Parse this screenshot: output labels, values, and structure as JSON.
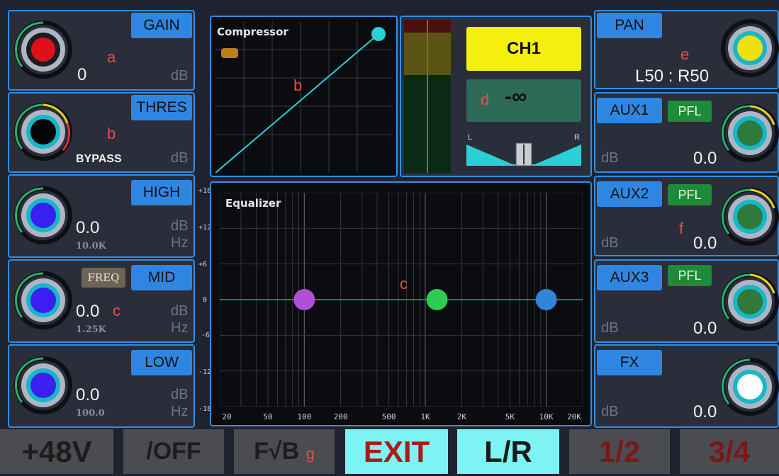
{
  "left": {
    "gain": {
      "label": "GAIN",
      "value": "0",
      "unit": "dB",
      "marker": "a",
      "knob_color": "#e0101a"
    },
    "thres": {
      "label": "THRES",
      "value": "BYPASS",
      "unit": "dB",
      "marker": "b",
      "knob_color": "#050505"
    },
    "high": {
      "label": "HIGH",
      "value": "0.0",
      "unit_db": "dB",
      "unit_hz": "Hz",
      "freq": "10.0K",
      "knob_color": "#3a1ff0"
    },
    "mid": {
      "label": "MID",
      "freq_button": "FREQ",
      "value": "0.0",
      "marker": "c",
      "unit_db": "dB",
      "unit_hz": "Hz",
      "freq": "1.25K",
      "knob_color": "#3a1ff0"
    },
    "low": {
      "label": "LOW",
      "value": "0.0",
      "unit_db": "dB",
      "unit_hz": "Hz",
      "freq": "100.0",
      "knob_color": "#3a1ff0"
    }
  },
  "compressor": {
    "title": "Compressor",
    "marker": "b"
  },
  "meter": {
    "channel": "CH1",
    "fader_value": "-∞",
    "marker": "d",
    "l": "L",
    "r": "R"
  },
  "equalizer": {
    "title": "Equalizer",
    "marker": "c",
    "y_ticks": [
      "+18",
      "+12",
      "+6",
      "0",
      "-6",
      "-12",
      "-18"
    ],
    "x_ticks": [
      "20",
      "50",
      "100",
      "200",
      "500",
      "1K",
      "2K",
      "5K",
      "10K",
      "20K"
    ],
    "bands": [
      {
        "name": "low",
        "freq_hz": 100,
        "gain_db": 0,
        "color": "#b14fd6"
      },
      {
        "name": "mid",
        "freq_hz": 1250,
        "gain_db": 0,
        "color": "#2ecc55"
      },
      {
        "name": "high",
        "freq_hz": 10000,
        "gain_db": 0,
        "color": "#2f86d6"
      }
    ]
  },
  "right": {
    "pan": {
      "label": "PAN",
      "value": "L50 : R50",
      "marker": "e",
      "knob_color": "#f0e010"
    },
    "aux1": {
      "label": "AUX1",
      "pfl": "PFL",
      "unit": "dB",
      "value": "0.0",
      "knob_color": "#2f7a3a"
    },
    "aux2": {
      "label": "AUX2",
      "pfl": "PFL",
      "unit": "dB",
      "value": "0.0",
      "marker": "f",
      "knob_color": "#2f7a3a"
    },
    "aux3": {
      "label": "AUX3",
      "pfl": "PFL",
      "unit": "dB",
      "value": "0.0",
      "knob_color": "#2f7a3a"
    },
    "fx": {
      "label": "FX",
      "unit": "dB",
      "value": "0.0",
      "knob_color": "#ffffff"
    }
  },
  "bottom": {
    "phantom": "+48V",
    "phase": "/OFF",
    "fb": "F√B",
    "marker": "g",
    "exit": "EXIT",
    "lr": "L/R",
    "p12": "1/2",
    "p34": "3/4"
  }
}
